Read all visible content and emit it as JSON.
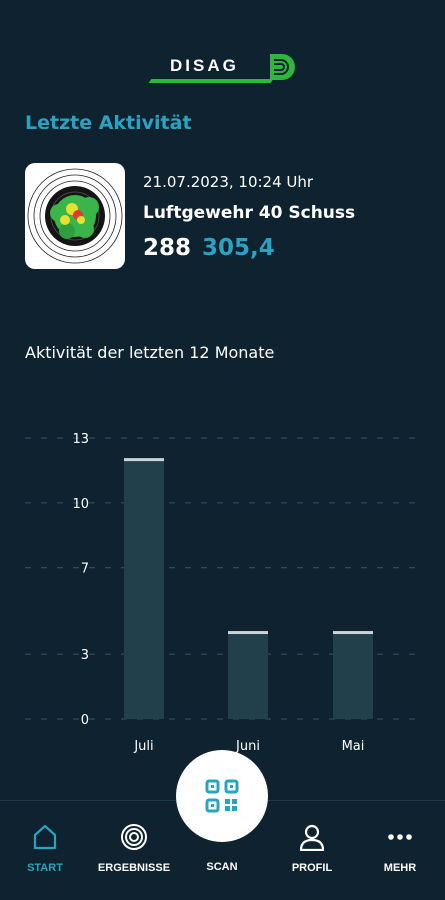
{
  "brand": {
    "name": "DISAG",
    "accent": "#2aa3c2",
    "logo_green": "#2fb63f"
  },
  "latest": {
    "section_title": "Letzte Aktivität",
    "date": "21.07.2023, 10:24 Uhr",
    "discipline": "Luftgewehr 40 Schuss",
    "score_int": "288",
    "score_dec": "305,4"
  },
  "chart_section_title": "Aktivität der letzten 12 Monate",
  "chart_data": {
    "type": "bar",
    "categories": [
      "Juli",
      "Juni",
      "Mai"
    ],
    "values": [
      12,
      4,
      4
    ],
    "yticks": [
      0,
      3,
      7,
      10,
      13
    ],
    "ylim": [
      0,
      13
    ],
    "grid": true,
    "colors": {
      "bar": "#22404c",
      "cap": "#c9d3d8",
      "grid": "#3a5463"
    }
  },
  "nav": {
    "items": [
      {
        "label": "START",
        "icon": "home-icon",
        "active": true
      },
      {
        "label": "ERGEBNISSE",
        "icon": "target-icon",
        "active": false
      },
      {
        "label": "SCAN",
        "icon": "qr-code-icon",
        "active": false
      },
      {
        "label": "PROFIL",
        "icon": "user-icon",
        "active": false
      },
      {
        "label": "MEHR",
        "icon": "more-icon",
        "active": false
      }
    ]
  }
}
